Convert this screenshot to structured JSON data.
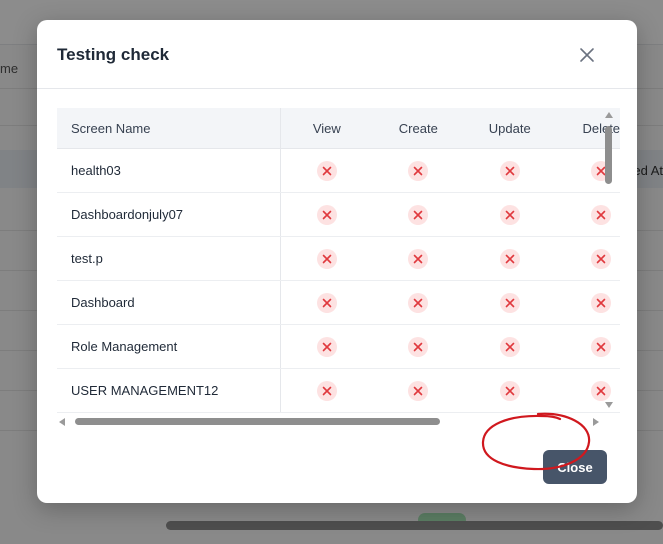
{
  "background": {
    "left_label": "me",
    "right_column_text": "ed At"
  },
  "modal": {
    "title": "Testing check",
    "close_icon": "close-icon",
    "table": {
      "columns": [
        "Screen Name",
        "View",
        "Create",
        "Update",
        "Delete"
      ],
      "rows": [
        {
          "name": "health03"
        },
        {
          "name": "Dashboardonjuly07"
        },
        {
          "name": "test.p"
        },
        {
          "name": "Dashboard"
        },
        {
          "name": "Role Management"
        },
        {
          "name": "USER MANAGEMENT12"
        }
      ],
      "permission_icon": "x-circle-icon"
    },
    "footer": {
      "close_label": "Close"
    }
  },
  "colors": {
    "accent_button": "#475569",
    "x_icon": "#e0393e",
    "x_icon_bg": "#fde2e2",
    "annotation": "#d0181e"
  }
}
